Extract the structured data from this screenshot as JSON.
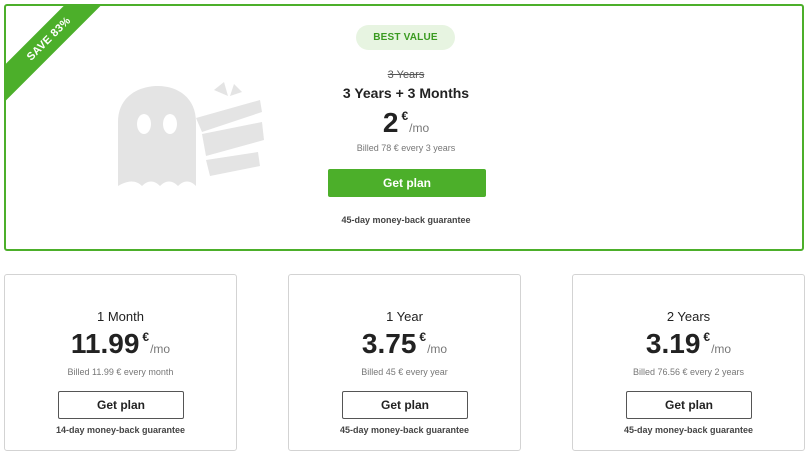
{
  "featured": {
    "ribbon": "SAVE 83%",
    "badge": "BEST VALUE",
    "old_term": "3 Years",
    "term": "3 Years + 3 Months",
    "price": "2",
    "currency": "€",
    "per": "/mo",
    "billed": "Billed 78 € every 3 years",
    "button": "Get plan",
    "guarantee": "45-day money-back guarantee",
    "accent_color": "#4caf2a",
    "logo_icon": "ghost-mascot-icon"
  },
  "plans": [
    {
      "term": "1 Month",
      "price": "11.99",
      "currency": "€",
      "per": "/mo",
      "billed": "Billed 11.99 € every month",
      "button": "Get plan",
      "guarantee": "14-day money-back guarantee"
    },
    {
      "term": "1 Year",
      "price": "3.75",
      "currency": "€",
      "per": "/mo",
      "billed": "Billed 45 € every year",
      "button": "Get plan",
      "guarantee": "45-day money-back guarantee"
    },
    {
      "term": "2 Years",
      "price": "3.19",
      "currency": "€",
      "per": "/mo",
      "billed": "Billed 76.56 € every 2 years",
      "button": "Get plan",
      "guarantee": "45-day money-back guarantee"
    }
  ]
}
